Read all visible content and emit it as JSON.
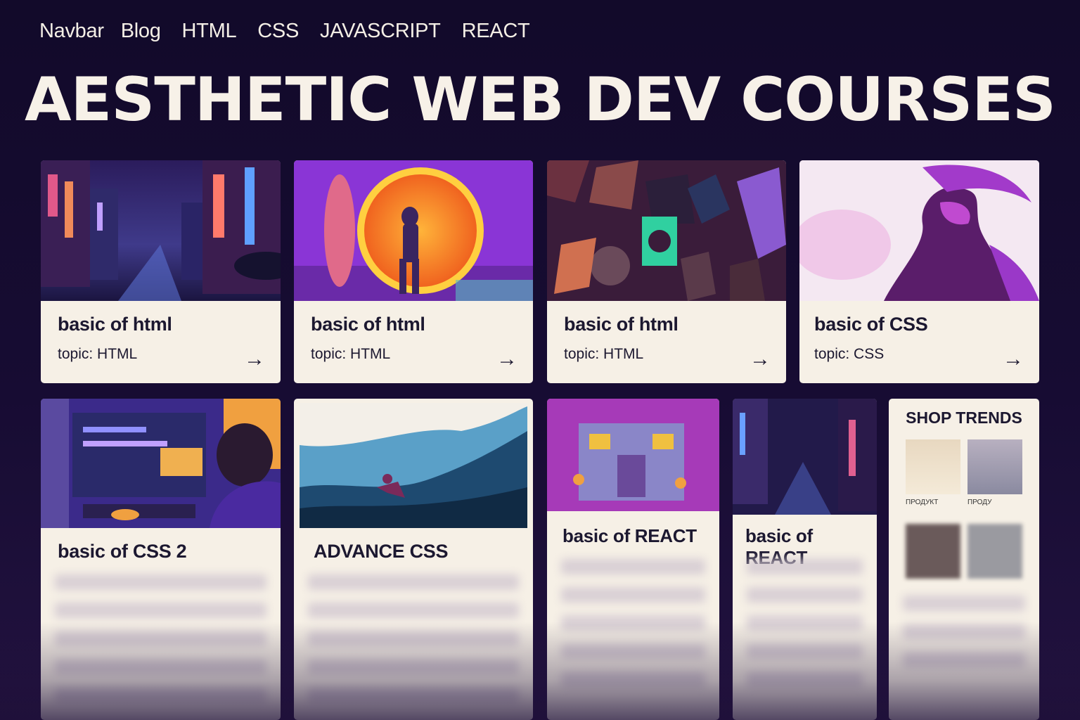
{
  "nav": {
    "items": [
      "Navbar",
      "Blog",
      "HTML",
      "CSS",
      "JAVASCRIPT",
      "REACT"
    ]
  },
  "title": "AESTHETIC WEB DEV COURSES",
  "cards": [
    {
      "title": "basic of html",
      "topic": "topic: HTML",
      "arrow": "→"
    },
    {
      "title": "basic of html",
      "topic": "topic: HTML",
      "arrow": "→"
    },
    {
      "title": "basic of html",
      "topic": "topic: HTML",
      "arrow": "→"
    },
    {
      "title": "basic of CSS",
      "topic": "topic: CSS",
      "arrow": "→"
    },
    {
      "title": "basic of CSS 2"
    },
    {
      "title": "ADVANCE CSS"
    },
    {
      "title": "basic of REACT"
    },
    {
      "title": "basic of REACT"
    }
  ],
  "shop": {
    "title": "SHOP TRENDS",
    "products": [
      {
        "label": "ПРОДУКТ"
      },
      {
        "label": "ПРОДУ"
      }
    ]
  },
  "colors": {
    "background": "#170c33",
    "card": "#f6f0e6",
    "accent": "#8a35d6"
  },
  "icons": [
    "arrow-right-icon"
  ]
}
